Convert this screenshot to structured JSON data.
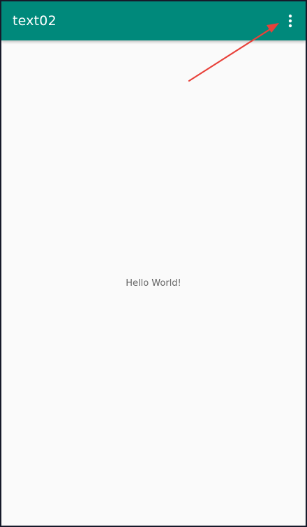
{
  "app": {
    "title": "text02",
    "bar_color": "#00897b"
  },
  "toolbar": {
    "overflow_icon": "more-vert-icon"
  },
  "content": {
    "message": "Hello World!"
  },
  "annotation": {
    "arrow_color": "#e8413a"
  }
}
